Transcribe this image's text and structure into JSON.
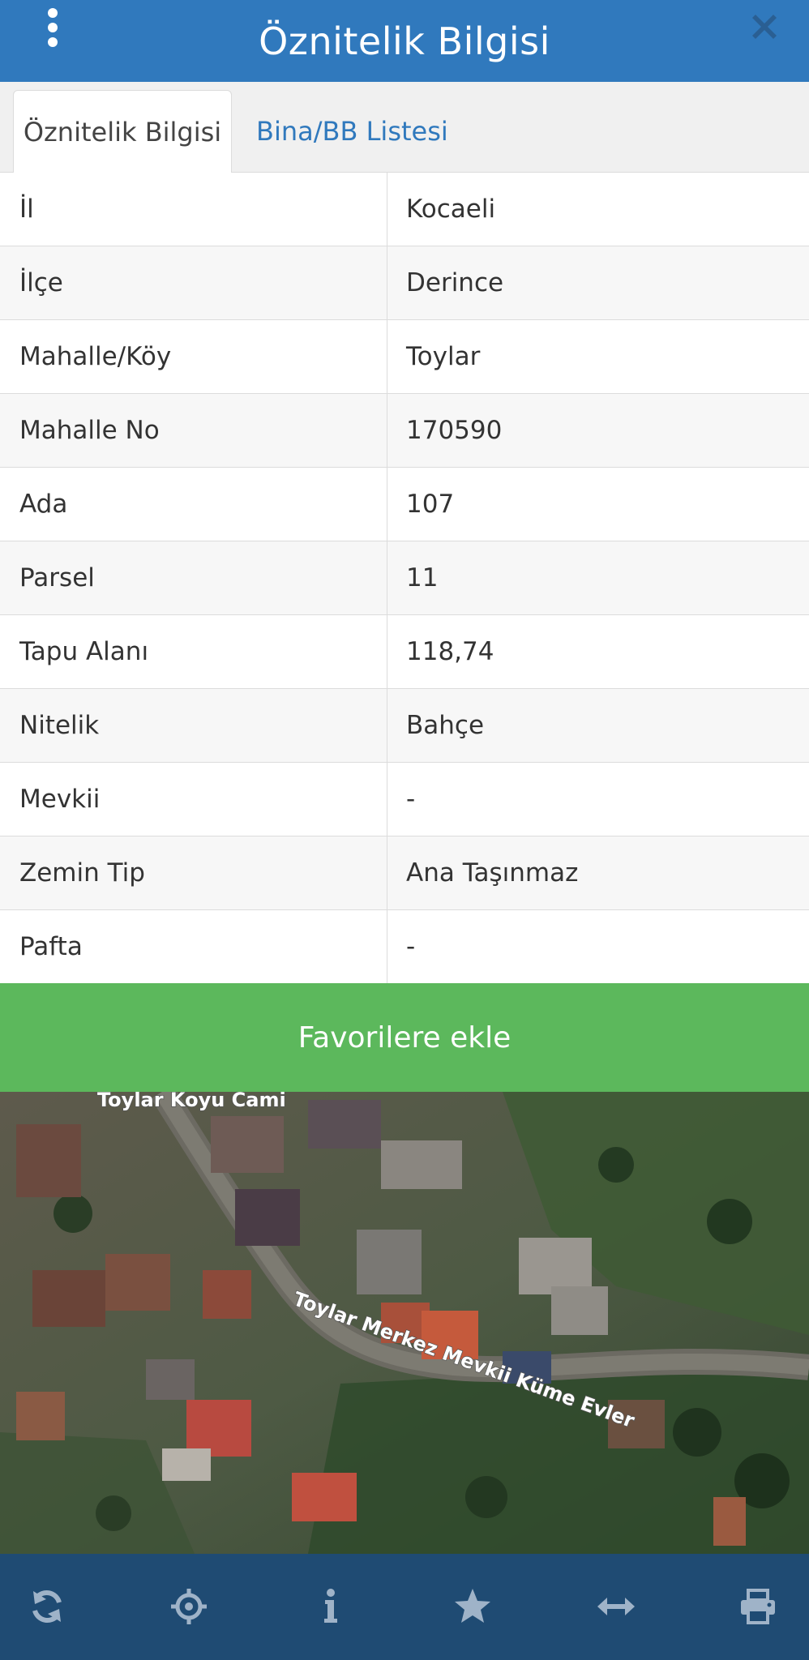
{
  "header": {
    "title": "Öznitelik Bilgisi"
  },
  "tabs": [
    {
      "label": "Öznitelik Bilgisi",
      "active": true
    },
    {
      "label": "Bina/BB Listesi",
      "active": false
    }
  ],
  "attributes": [
    {
      "label": "İl",
      "value": "Kocaeli"
    },
    {
      "label": "İlçe",
      "value": "Derince"
    },
    {
      "label": "Mahalle/Köy",
      "value": "Toylar"
    },
    {
      "label": "Mahalle No",
      "value": "170590"
    },
    {
      "label": "Ada",
      "value": "107"
    },
    {
      "label": "Parsel",
      "value": "11"
    },
    {
      "label": "Tapu Alanı",
      "value": "118,74"
    },
    {
      "label": "Nitelik",
      "value": "Bahçe"
    },
    {
      "label": "Mevkii",
      "value": "-"
    },
    {
      "label": "Zemin Tip",
      "value": "Ana Taşınmaz"
    },
    {
      "label": "Pafta",
      "value": "-"
    }
  ],
  "actions": {
    "favorite_label": "Favorilere ekle"
  },
  "map": {
    "labels": {
      "mosque": "Toylar Koyu Cami",
      "street": "Toylar Merkez Mevkii Küme Evler"
    }
  },
  "bottombar": {
    "icons": [
      "refresh-icon",
      "locate-icon",
      "info-icon",
      "star-icon",
      "measure-icon",
      "print-icon"
    ]
  },
  "colors": {
    "header": "#3079bd",
    "accent_green": "#5cb85c",
    "bottombar": "#1f4b73",
    "tab_link": "#3079bd"
  }
}
